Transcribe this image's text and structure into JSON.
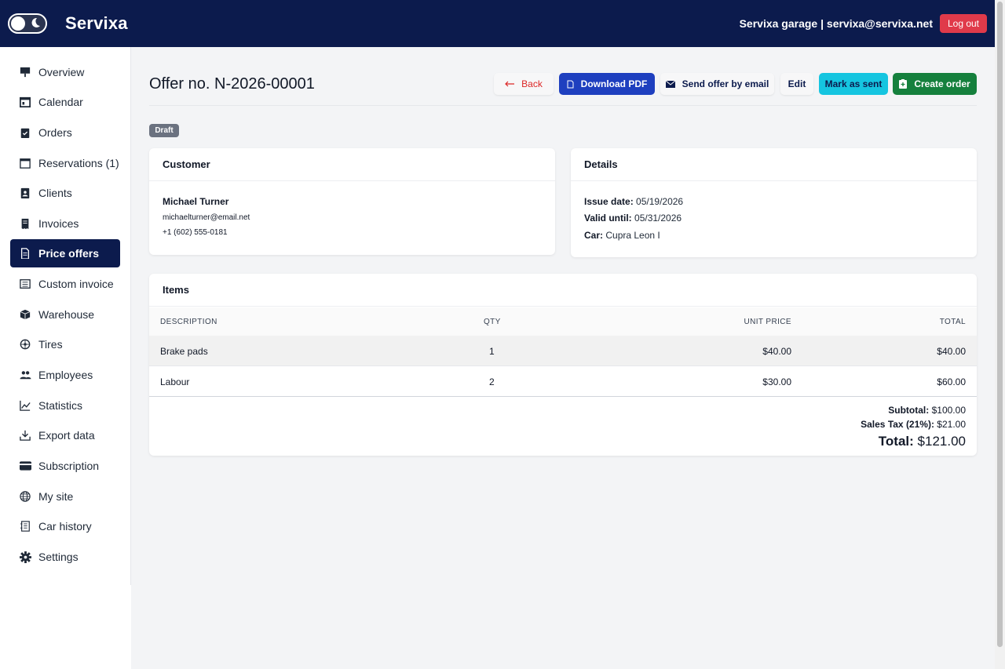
{
  "app": {
    "brand": "Servixa",
    "user_label": "Servixa garage | servixa@servixa.net",
    "logout_label": "Log out"
  },
  "sidebar": {
    "items": [
      {
        "label": "Overview",
        "icon": "presentation-icon"
      },
      {
        "label": "Calendar",
        "icon": "calendar-icon"
      },
      {
        "label": "Orders",
        "icon": "clipboard-check-icon"
      },
      {
        "label": "Reservations (1)",
        "icon": "calendar-blank-icon"
      },
      {
        "label": "Clients",
        "icon": "person-badge-icon"
      },
      {
        "label": "Invoices",
        "icon": "receipt-icon"
      },
      {
        "label": "Price offers",
        "icon": "document-icon",
        "active": true
      },
      {
        "label": "Custom invoice",
        "icon": "list-doc-icon"
      },
      {
        "label": "Warehouse",
        "icon": "box-icon"
      },
      {
        "label": "Tires",
        "icon": "tire-icon"
      },
      {
        "label": "Employees",
        "icon": "people-icon"
      },
      {
        "label": "Statistics",
        "icon": "graph-icon"
      },
      {
        "label": "Export data",
        "icon": "download-icon"
      },
      {
        "label": "Subscription",
        "icon": "credit-card-icon"
      },
      {
        "label": "My site",
        "icon": "globe-icon"
      },
      {
        "label": "Car history",
        "icon": "journal-icon"
      },
      {
        "label": "Settings",
        "icon": "gear-icon"
      }
    ]
  },
  "page": {
    "title": "Offer no. N-2026-00001",
    "status": "Draft",
    "actions": {
      "back": "Back",
      "download_pdf": "Download PDF",
      "send_email": "Send offer by email",
      "edit": "Edit",
      "mark_sent": "Mark as sent",
      "create_order": "Create order"
    }
  },
  "customer": {
    "heading": "Customer",
    "name": "Michael Turner",
    "email": "michaelturner@email.net",
    "phone": "+1 (602) 555-0181"
  },
  "details": {
    "heading": "Details",
    "issue_label": "Issue date:",
    "issue_value": "05/19/2026",
    "valid_label": "Valid until:",
    "valid_value": "05/31/2026",
    "car_label": "Car:",
    "car_value": "Cupra Leon I"
  },
  "items": {
    "heading": "Items",
    "columns": [
      "DESCRIPTION",
      "QTY",
      "UNIT PRICE",
      "TOTAL"
    ],
    "rows": [
      {
        "description": "Brake pads",
        "qty": "1",
        "unit_price": "$40.00",
        "total": "$40.00"
      },
      {
        "description": "Labour",
        "qty": "2",
        "unit_price": "$30.00",
        "total": "$60.00"
      }
    ],
    "subtotal_label": "Subtotal:",
    "subtotal_value": "$100.00",
    "tax_label": "Sales Tax (21%):",
    "tax_value": "$21.00",
    "total_label": "Total:",
    "total_value": "$121.00"
  },
  "colors": {
    "navy": "#0c1b4d",
    "primary": "#1e3fbf",
    "success": "#15803d",
    "info": "#15c5e0",
    "danger": "#e03a4a"
  }
}
